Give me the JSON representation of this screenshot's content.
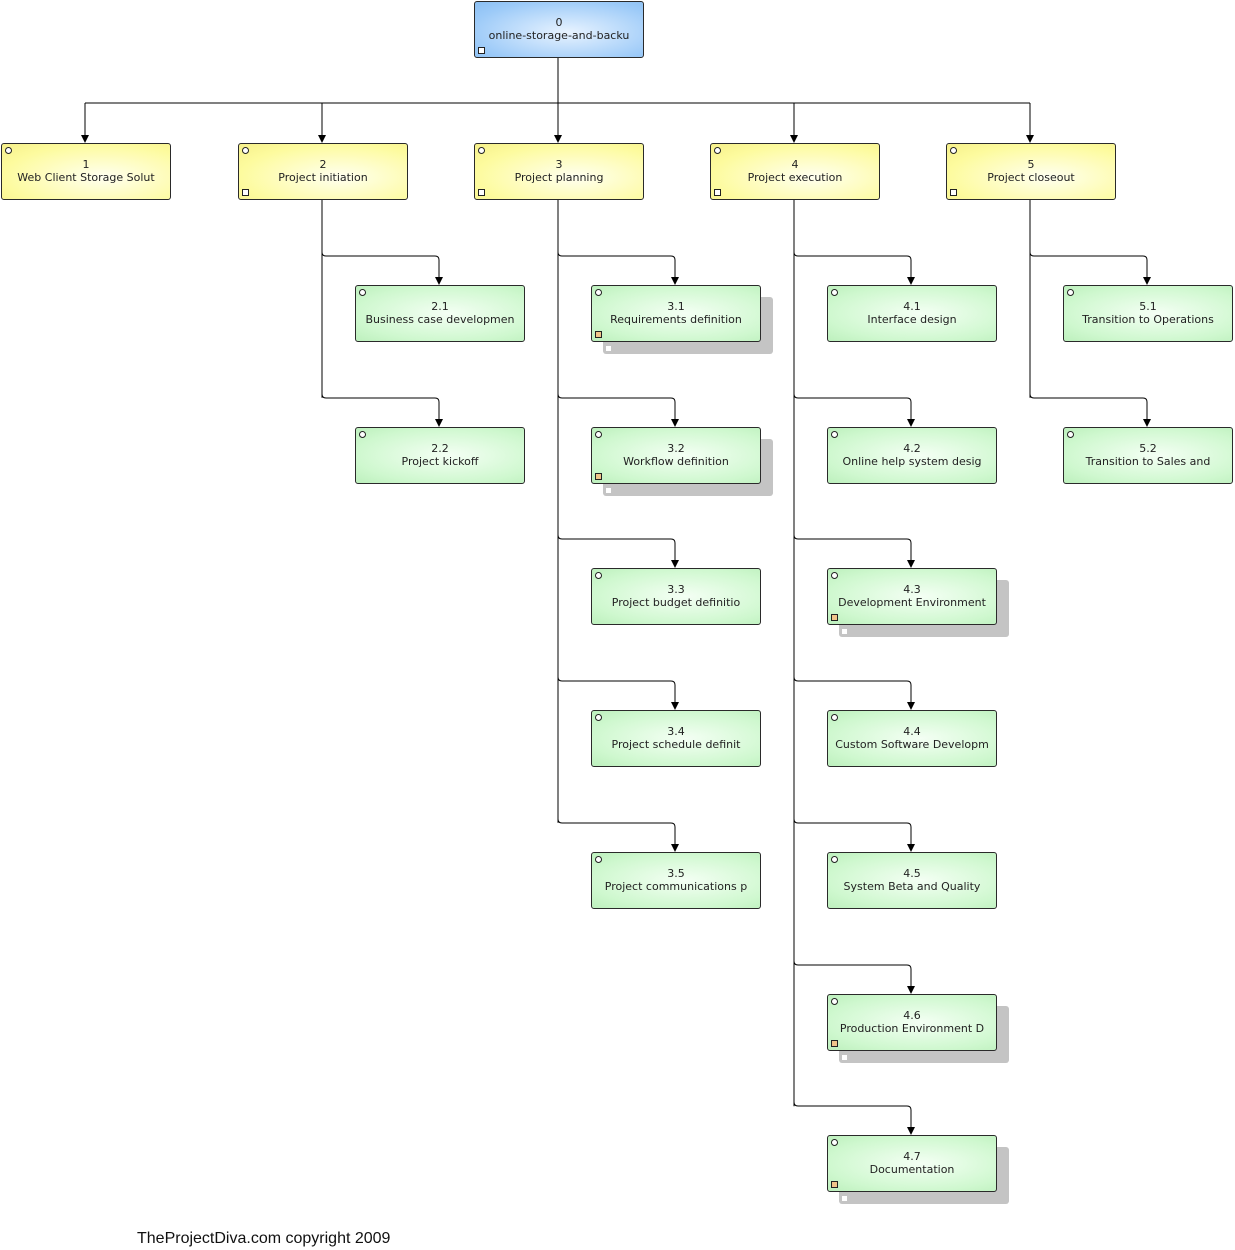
{
  "colors": {
    "root": "#9ccaf8",
    "summary": "#fdfb9e",
    "task": "#cff8cf",
    "shadow": "#c4c4c4",
    "line": "#000000"
  },
  "root": {
    "number": "0",
    "label": "online-storage-and-backu"
  },
  "branches": [
    {
      "number": "1",
      "label": "Web Client Storage Solut",
      "children": []
    },
    {
      "number": "2",
      "label": "Project initiation",
      "children": [
        {
          "number": "2.1",
          "label": "Business case developmen",
          "stacked": false
        },
        {
          "number": "2.2",
          "label": "Project kickoff",
          "stacked": false
        }
      ]
    },
    {
      "number": "3",
      "label": "Project planning",
      "children": [
        {
          "number": "3.1",
          "label": "Requirements definition",
          "stacked": true
        },
        {
          "number": "3.2",
          "label": "Workflow definition",
          "stacked": true
        },
        {
          "number": "3.3",
          "label": "Project budget definitio",
          "stacked": false
        },
        {
          "number": "3.4",
          "label": "Project schedule definit",
          "stacked": false
        },
        {
          "number": "3.5",
          "label": "Project communications p",
          "stacked": false
        }
      ]
    },
    {
      "number": "4",
      "label": "Project execution",
      "children": [
        {
          "number": "4.1",
          "label": "Interface design",
          "stacked": false
        },
        {
          "number": "4.2",
          "label": "Online help system desig",
          "stacked": false
        },
        {
          "number": "4.3",
          "label": "Development Environment",
          "stacked": true
        },
        {
          "number": "4.4",
          "label": "Custom Software Developm",
          "stacked": false
        },
        {
          "number": "4.5",
          "label": "System Beta and Quality",
          "stacked": false
        },
        {
          "number": "4.6",
          "label": "Production Environment D",
          "stacked": true
        },
        {
          "number": "4.7",
          "label": "Documentation",
          "stacked": true
        }
      ]
    },
    {
      "number": "5",
      "label": "Project closeout",
      "children": [
        {
          "number": "5.1",
          "label": "Transition to Operations",
          "stacked": false
        },
        {
          "number": "5.2",
          "label": "Transition to Sales and",
          "stacked": false
        }
      ]
    }
  ],
  "footer": "TheProjectDiva.com copyright 2009"
}
